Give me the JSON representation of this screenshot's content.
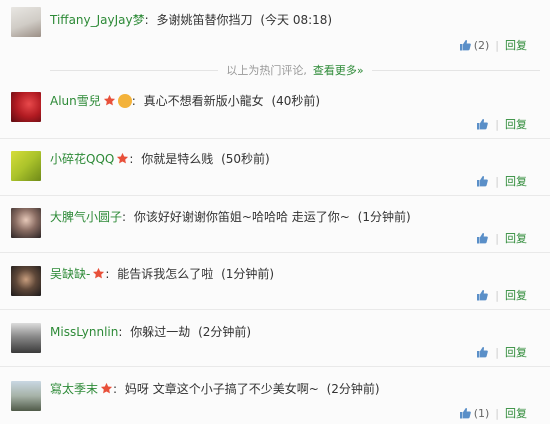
{
  "hot_comment": {
    "user": "Tiffany_JayJay梦",
    "text": "多谢姚笛替你挡刀",
    "time": "(今天 08:18)",
    "likes": "(2)",
    "reply": "回复"
  },
  "divider": {
    "text": "以上为热门评论,",
    "more": "查看更多»"
  },
  "comments": [
    {
      "user": "Alun雪兒",
      "text": "真心不想看新版小龍女",
      "time": "(40秒前)",
      "likes": "",
      "reply": "回复",
      "star": true,
      "emoji": true
    },
    {
      "user": "小碎花QQQ",
      "text": "你就是特么贱",
      "time": "(50秒前)",
      "likes": "",
      "reply": "回复",
      "star": true,
      "emoji": false
    },
    {
      "user": "大脾气小圆子",
      "text": "你该好好谢谢你笛姐~哈哈哈 走运了你~",
      "time": "(1分钟前)",
      "likes": "",
      "reply": "回复",
      "star": false,
      "emoji": false
    },
    {
      "user": "吴缺缺-",
      "text": "能告诉我怎么了啦",
      "time": "(1分钟前)",
      "likes": "",
      "reply": "回复",
      "star": true,
      "emoji": false
    },
    {
      "user": "MissLynnlin",
      "text": "你躲过一劫",
      "time": "(2分钟前)",
      "likes": "",
      "reply": "回复",
      "star": false,
      "emoji": false
    },
    {
      "user": "寫太季末",
      "text": "妈呀 文章这个小子搞了不少美女啊~",
      "time": "(2分钟前)",
      "likes": "(1)",
      "reply": "回复",
      "star": true,
      "emoji": false
    }
  ],
  "colors": {
    "link": "#2d8a37",
    "text": "#333333",
    "star": "#e8503a"
  }
}
